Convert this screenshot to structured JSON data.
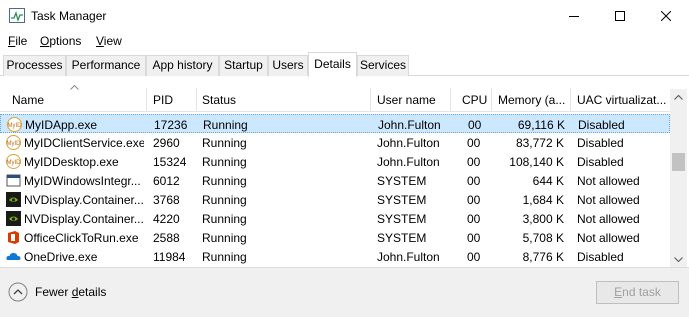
{
  "window": {
    "title": "Task Manager",
    "icon": "task-manager-icon"
  },
  "menu": {
    "file_prefix": "F",
    "file_rest": "ile",
    "options_prefix": "O",
    "options_rest": "ptions",
    "view_prefix": "V",
    "view_rest": "iew"
  },
  "tabs": [
    "Processes",
    "Performance",
    "App history",
    "Startup",
    "Users",
    "Details",
    "Services"
  ],
  "active_tab": "Details",
  "columns": {
    "name": "Name",
    "pid": "PID",
    "status": "Status",
    "user": "User name",
    "cpu": "CPU",
    "memory": "Memory (a...",
    "uac": "UAC virtualizat..."
  },
  "rows": [
    {
      "name": "MyIDApp.exe",
      "pid": "17236",
      "status": "Running",
      "user": "John.Fulton",
      "cpu": "00",
      "memory": "69,116 K",
      "uac": "Disabled",
      "icon": "myid-icon",
      "selected": true
    },
    {
      "name": "MyIDClientService.exe",
      "pid": "2960",
      "status": "Running",
      "user": "John.Fulton",
      "cpu": "00",
      "memory": "83,772 K",
      "uac": "Disabled",
      "icon": "myid-icon"
    },
    {
      "name": "MyIDDesktop.exe",
      "pid": "15324",
      "status": "Running",
      "user": "John.Fulton",
      "cpu": "00",
      "memory": "108,140 K",
      "uac": "Disabled",
      "icon": "myid-icon"
    },
    {
      "name": "MyIDWindowsIntegr...",
      "pid": "6012",
      "status": "Running",
      "user": "SYSTEM",
      "cpu": "00",
      "memory": "644 K",
      "uac": "Not allowed",
      "icon": "exe-window-icon"
    },
    {
      "name": "NVDisplay.Container...",
      "pid": "3768",
      "status": "Running",
      "user": "SYSTEM",
      "cpu": "00",
      "memory": "1,684 K",
      "uac": "Not allowed",
      "icon": "nvidia-icon"
    },
    {
      "name": "NVDisplay.Container...",
      "pid": "4220",
      "status": "Running",
      "user": "SYSTEM",
      "cpu": "00",
      "memory": "3,800 K",
      "uac": "Not allowed",
      "icon": "nvidia-icon"
    },
    {
      "name": "OfficeClickToRun.exe",
      "pid": "2588",
      "status": "Running",
      "user": "SYSTEM",
      "cpu": "00",
      "memory": "5,708 K",
      "uac": "Not allowed",
      "icon": "office-icon"
    },
    {
      "name": "OneDrive.exe",
      "pid": "11984",
      "status": "Running",
      "user": "John.Fulton",
      "cpu": "00",
      "memory": "8,776 K",
      "uac": "Disabled",
      "icon": "onedrive-icon"
    }
  ],
  "footer": {
    "fewer_prefix": "Fewer ",
    "fewer_underlined": "d",
    "fewer_rest": "etails",
    "end_task_underlined": "E",
    "end_task_rest": "nd task"
  },
  "colors": {
    "selected_row": "#cce8ff",
    "footer_bg": "#f0f0f0",
    "nvidia_green": "#76b900",
    "office_red": "#d83b01",
    "onedrive_blue": "#0f78d4"
  }
}
